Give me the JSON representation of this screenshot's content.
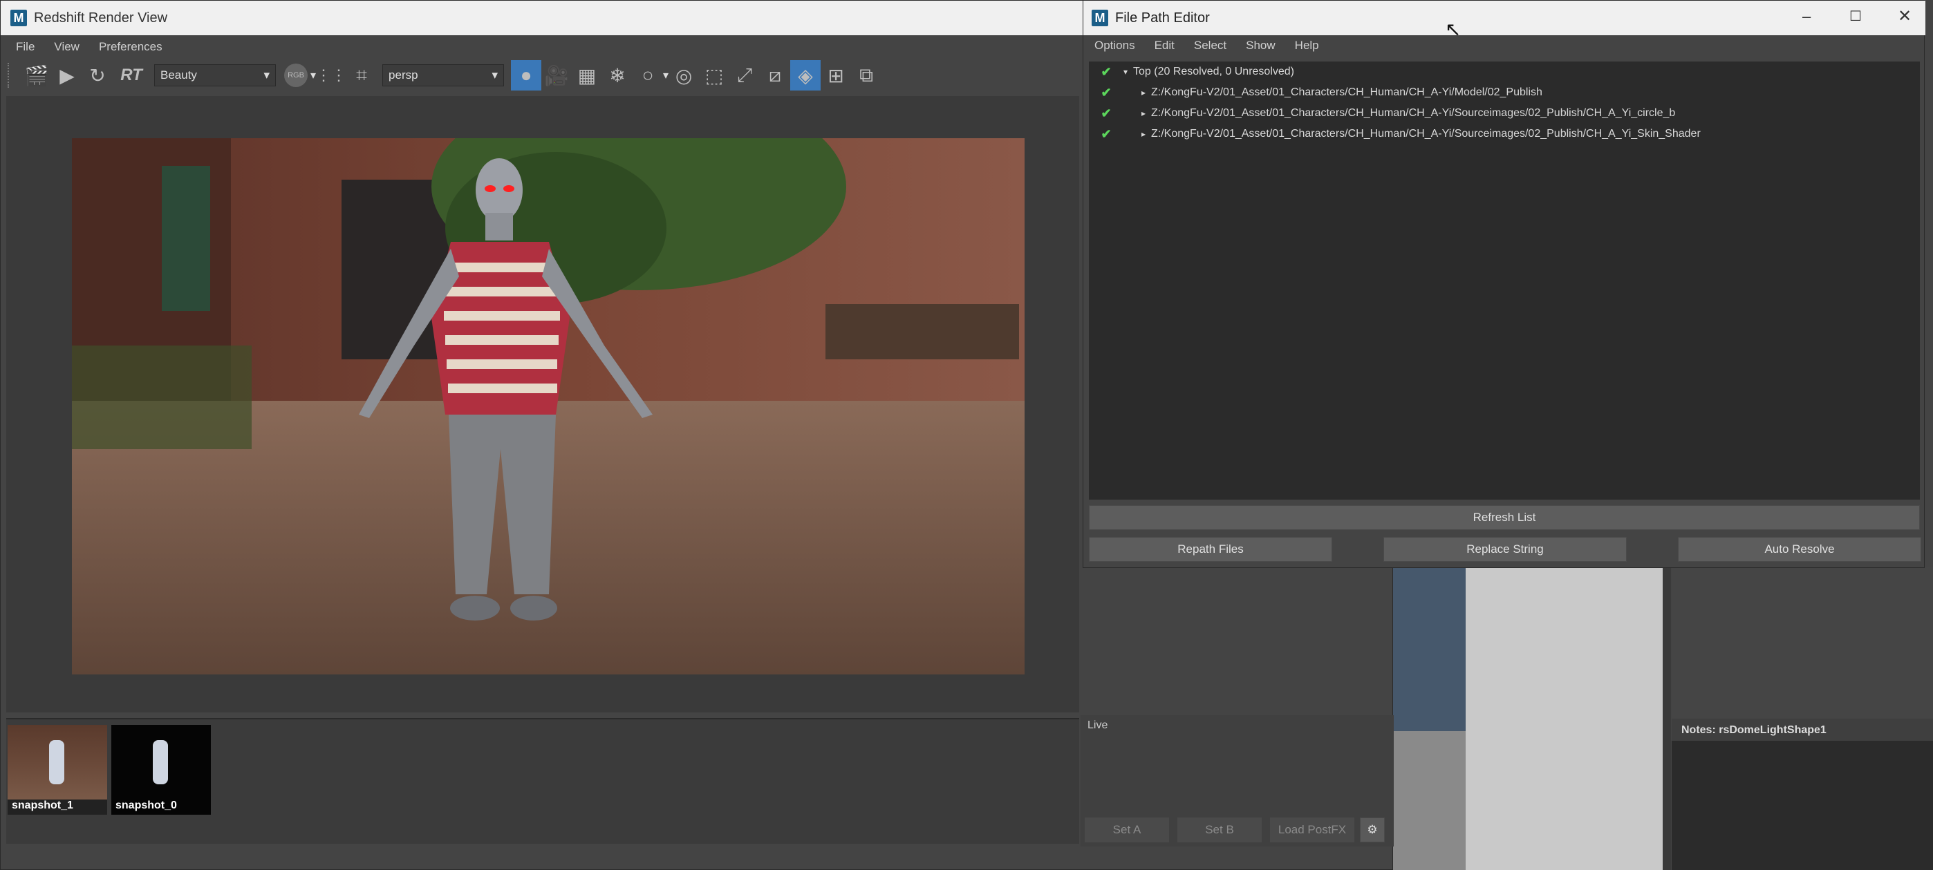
{
  "render_view": {
    "title": "Redshift Render View",
    "menu": [
      "File",
      "View",
      "Preferences"
    ],
    "aov_value": "Beauty",
    "rt_label": "RT",
    "rgb_label": "RGB",
    "camera_value": "persp",
    "snapshots": [
      {
        "label": "snapshot_1"
      },
      {
        "label": "snapshot_0"
      }
    ]
  },
  "fpe": {
    "title": "File Path Editor",
    "menu": [
      "Options",
      "Edit",
      "Select",
      "Show",
      "Help"
    ],
    "top_label": "Top (20 Resolved, 0 Unresolved)",
    "paths": [
      "Z:/KongFu-V2/01_Asset/01_Characters/CH_Human/CH_A-Yi/Model/02_Publish",
      "Z:/KongFu-V2/01_Asset/01_Characters/CH_Human/CH_A-Yi/Sourceimages/02_Publish/CH_A_Yi_circle_b",
      "Z:/KongFu-V2/01_Asset/01_Characters/CH_Human/CH_A-Yi/Sourceimages/02_Publish/CH_A_Yi_Skin_Shader"
    ],
    "refresh_label": "Refresh List",
    "repath_label": "Repath Files",
    "replace_label": "Replace String",
    "autoresolve_label": "Auto Resolve"
  },
  "post": {
    "live_label": "Live",
    "set_a": "Set A",
    "set_b": "Set B",
    "load_postfx": "Load PostFX"
  },
  "notes": {
    "label": "Notes:  rsDomeLightShape1"
  },
  "colors": {
    "accent": "#2f6fb0",
    "check": "#5cd65c"
  }
}
